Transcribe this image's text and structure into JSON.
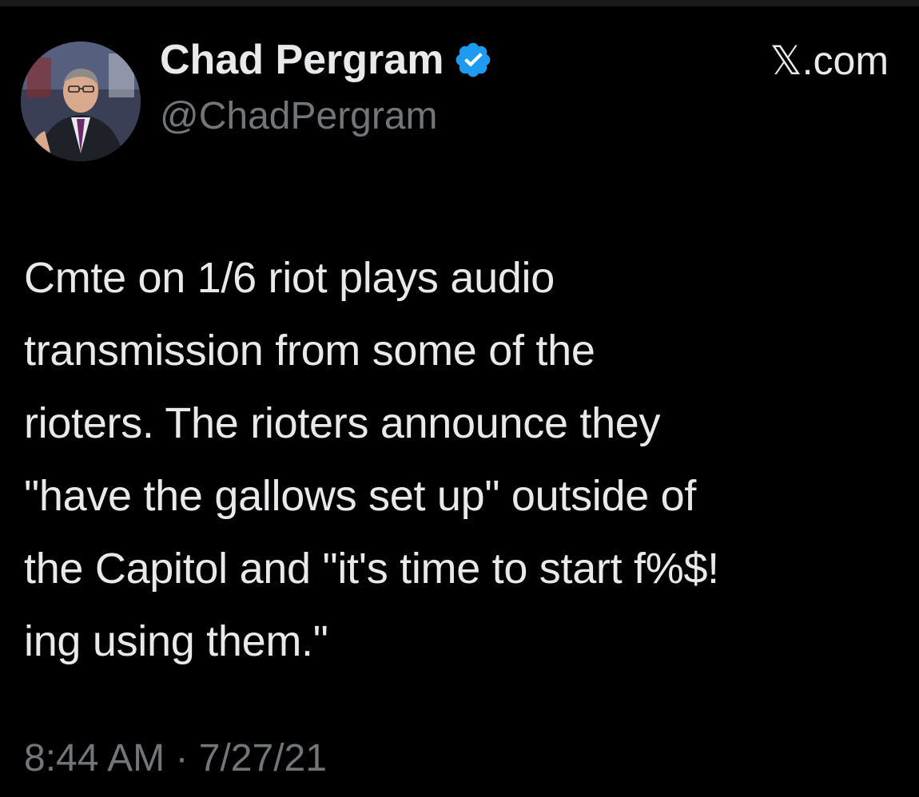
{
  "author": {
    "display_name": "Chad Pergram",
    "handle": "@ChadPergram",
    "verified": true,
    "avatar_icon": "profile-photo"
  },
  "brand": {
    "text": "𝕏.com"
  },
  "tweet": {
    "text": "Cmte on 1/6 riot plays audio\ntransmission from some of the\nrioters. The rioters announce they\n\"have the gallows set up\" outside of\nthe Capitol and \"it's time to start f%$!\ning using them.\""
  },
  "timestamp": {
    "time": "8:44 AM",
    "separator": " · ",
    "date": "7/27/21"
  },
  "colors": {
    "background": "#000000",
    "primary_text": "#e7e9ea",
    "secondary_text": "#71767b",
    "verified_blue": "#1d9bf0"
  }
}
